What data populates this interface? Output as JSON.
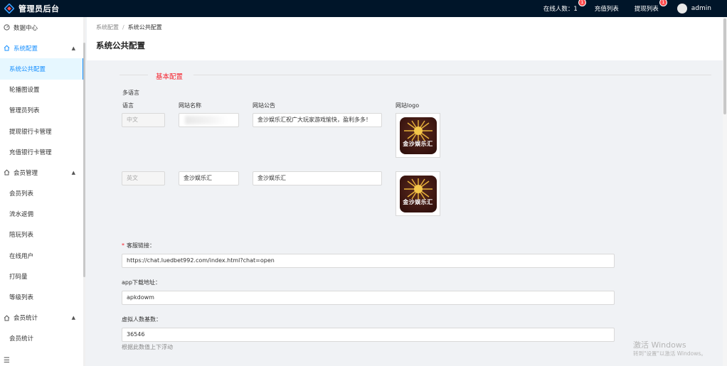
{
  "app": {
    "title": "管理员后台"
  },
  "topbar": {
    "online_label": "在线人数：1",
    "online_badge": "1",
    "recharge_label": "充值列表",
    "withdraw_label": "提现列表",
    "withdraw_badge": "1",
    "user_name": "admin"
  },
  "sidebar": {
    "items": [
      {
        "label": "数据中心",
        "icon": "dashboard-icon"
      },
      {
        "label": "系统配置",
        "icon": "home-icon",
        "expanded": true
      },
      {
        "label": "系统公共配置",
        "active": true
      },
      {
        "label": "轮播图设置"
      },
      {
        "label": "管理员列表"
      },
      {
        "label": "提现银行卡管理"
      },
      {
        "label": "充值银行卡管理"
      },
      {
        "label": "会员管理",
        "icon": "home-icon",
        "expanded": true
      },
      {
        "label": "会员列表"
      },
      {
        "label": "流水返佣"
      },
      {
        "label": "陪玩列表"
      },
      {
        "label": "在线用户"
      },
      {
        "label": "打码量"
      },
      {
        "label": "等级列表"
      },
      {
        "label": "会员统计",
        "icon": "home-icon",
        "expanded": true
      },
      {
        "label": "会员统计"
      }
    ],
    "collapse_icon": "menu-fold-icon"
  },
  "breadcrumb": {
    "parent": "系统配置",
    "separator": "/",
    "current": "系统公共配置"
  },
  "page_title": "系统公共配置",
  "section": {
    "title": "基本配置"
  },
  "multilang": {
    "heading": "多语言",
    "col_language": "语言",
    "col_site_name": "网站名称",
    "col_notice": "网站公告",
    "col_logo": "网站logo",
    "rows": [
      {
        "language": "中文",
        "site_name": "",
        "notice": "金沙娱乐汇祝广大玩家游戏愉快，盈利多多！",
        "logo_text": "金沙娱乐汇"
      },
      {
        "language": "英文",
        "site_name": "金沙娱乐汇",
        "notice": "金沙娱乐汇",
        "logo_text": "金沙娱乐汇"
      }
    ]
  },
  "fields": {
    "service_link": {
      "label": "客服链接：",
      "required": true,
      "value": "https://chat.luedbet992.com/index.html?chat=open"
    },
    "app_download": {
      "label": "app下载地址：",
      "value": "apkdowm"
    },
    "virtual_base": {
      "label": "虚拟人数基数：",
      "value": "36546",
      "hint": "根据此数值上下浮动"
    }
  },
  "watermark": {
    "line1": "激活 Windows",
    "line2": "转到\"设置\"以激活 Windows。"
  },
  "colors": {
    "topbar": "#001529",
    "accent": "#1890ff",
    "danger": "#f5222d"
  }
}
